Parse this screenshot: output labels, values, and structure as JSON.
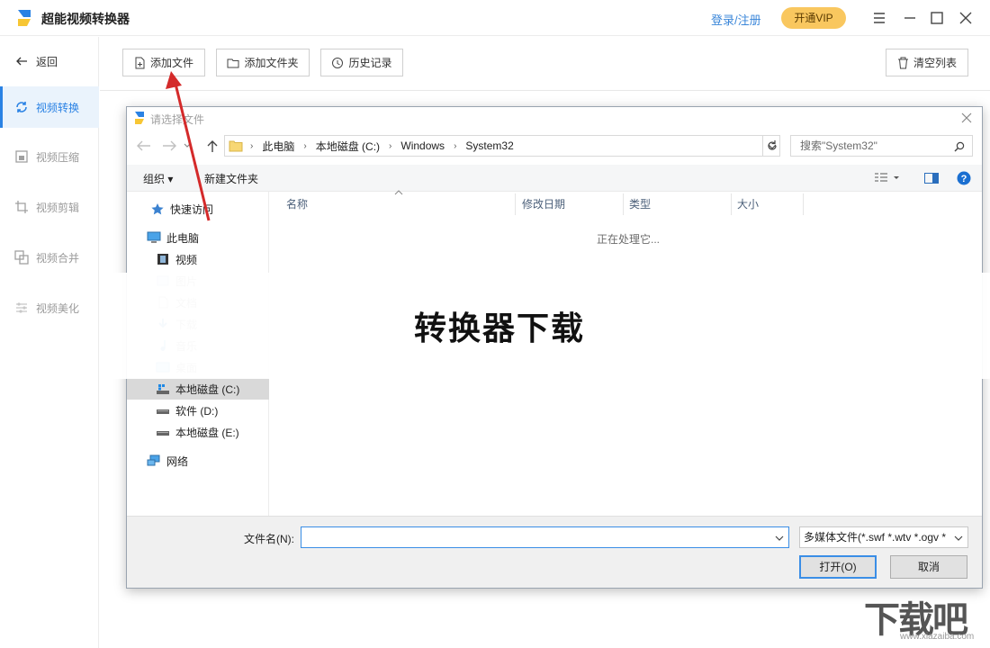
{
  "app": {
    "title": "超能视频转换器",
    "login": "登录/注册",
    "vip": "开通VIP",
    "brand_color": "#2a82e4"
  },
  "sidebar": {
    "back": "返回",
    "items": [
      {
        "label": "视频转换",
        "icon": "convert-icon",
        "active": true
      },
      {
        "label": "视频压缩",
        "icon": "compress-icon"
      },
      {
        "label": "视频剪辑",
        "icon": "crop-icon"
      },
      {
        "label": "视频合并",
        "icon": "merge-icon"
      },
      {
        "label": "视频美化",
        "icon": "beautify-icon"
      }
    ]
  },
  "toolbar": {
    "add_file": "添加文件",
    "add_folder": "添加文件夹",
    "history": "历史记录",
    "clear_list": "清空列表"
  },
  "dialog": {
    "title": "请选择文件",
    "breadcrumb": [
      "此电脑",
      "本地磁盘 (C:)",
      "Windows",
      "System32"
    ],
    "search_placeholder": "搜索\"System32\"",
    "organize": "组织",
    "new_folder": "新建文件夹",
    "columns": [
      "名称",
      "修改日期",
      "类型",
      "大小"
    ],
    "status": "正在处理它...",
    "nav": {
      "quick_access": "快速访问",
      "this_pc": "此电脑",
      "folders": [
        "视频",
        "图片",
        "文档",
        "下载",
        "音乐",
        "桌面"
      ],
      "drives": [
        "本地磁盘 (C:)",
        "软件 (D:)",
        "本地磁盘 (E:)"
      ],
      "network": "网络"
    },
    "filename_label": "文件名(N):",
    "filename_value": "",
    "filetype": "多媒体文件(*.swf *.wtv *.ogv *",
    "open_btn": "打开(O)",
    "cancel_btn": "取消"
  },
  "overlay_text": "转换器下载",
  "watermark": {
    "logo": "下载吧",
    "url": "www.xiazaiba.com"
  }
}
